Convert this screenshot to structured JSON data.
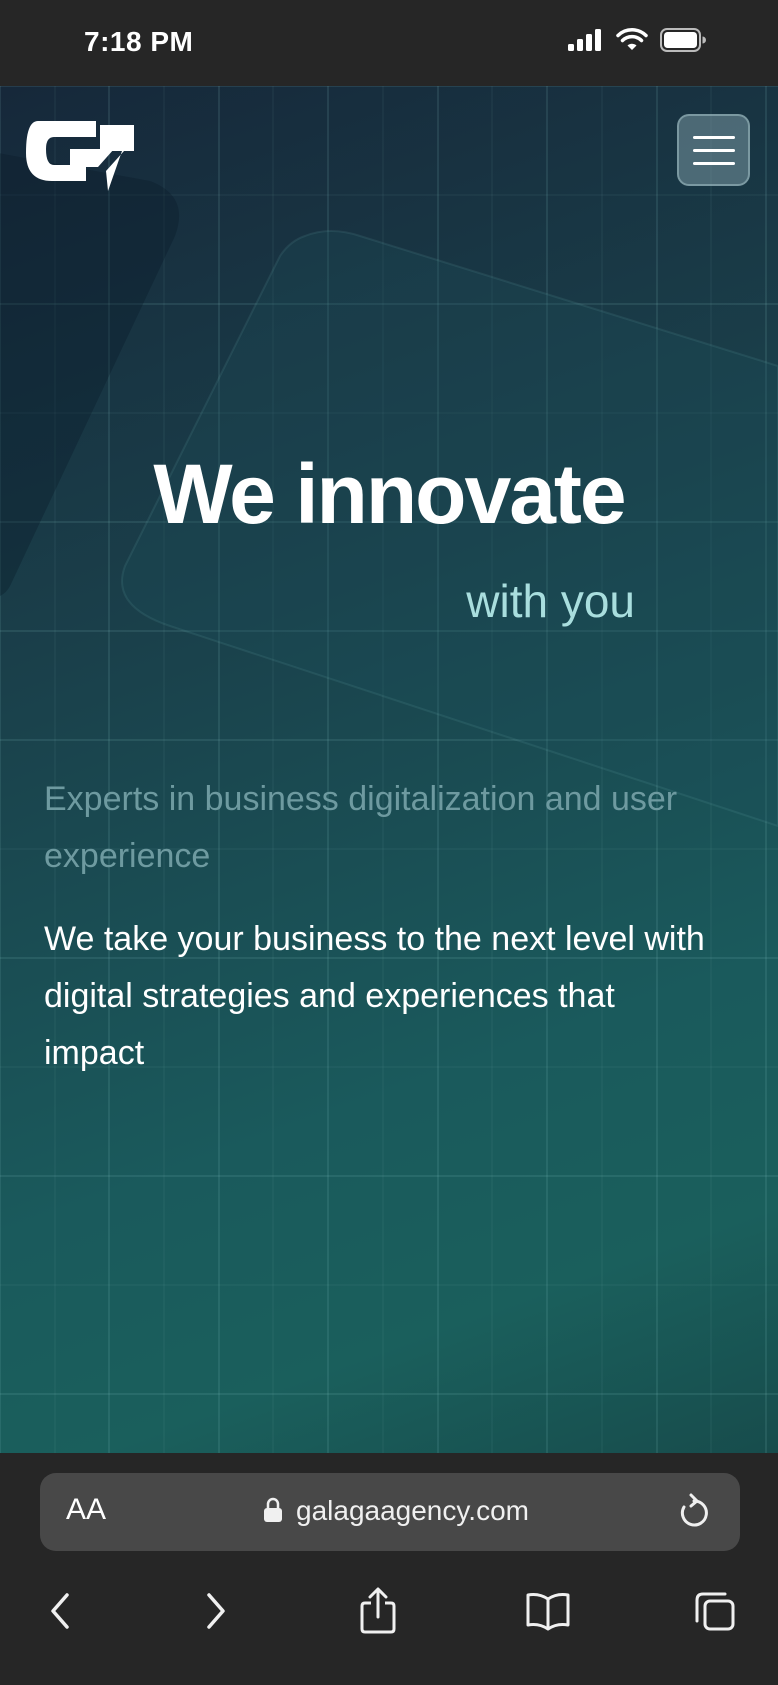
{
  "status_bar": {
    "time": "7:18 PM",
    "icons": [
      "signal-icon",
      "wifi-icon",
      "battery-icon"
    ]
  },
  "header": {
    "logo": "galaga-logo",
    "menu_icon": "hamburger-menu-icon"
  },
  "hero": {
    "headline": "We innovate",
    "subheadline": "with you",
    "tagline": "Experts in business digitalization and user experience",
    "description": "We take your business to the next level with digital strategies and experiences that impact"
  },
  "browser": {
    "text_size_label": "AA",
    "url": "galagaagency.com",
    "icons": [
      "lock-icon",
      "reload-icon",
      "back-icon",
      "forward-icon",
      "share-icon",
      "bookmarks-icon",
      "tabs-icon"
    ]
  },
  "colors": {
    "background_dark": "#262626",
    "hero_start": "#16283a",
    "hero_end": "#1a5f5c",
    "subheadline": "#a9dede",
    "tagline": "#6e9aa0",
    "url_field": "#484848"
  }
}
